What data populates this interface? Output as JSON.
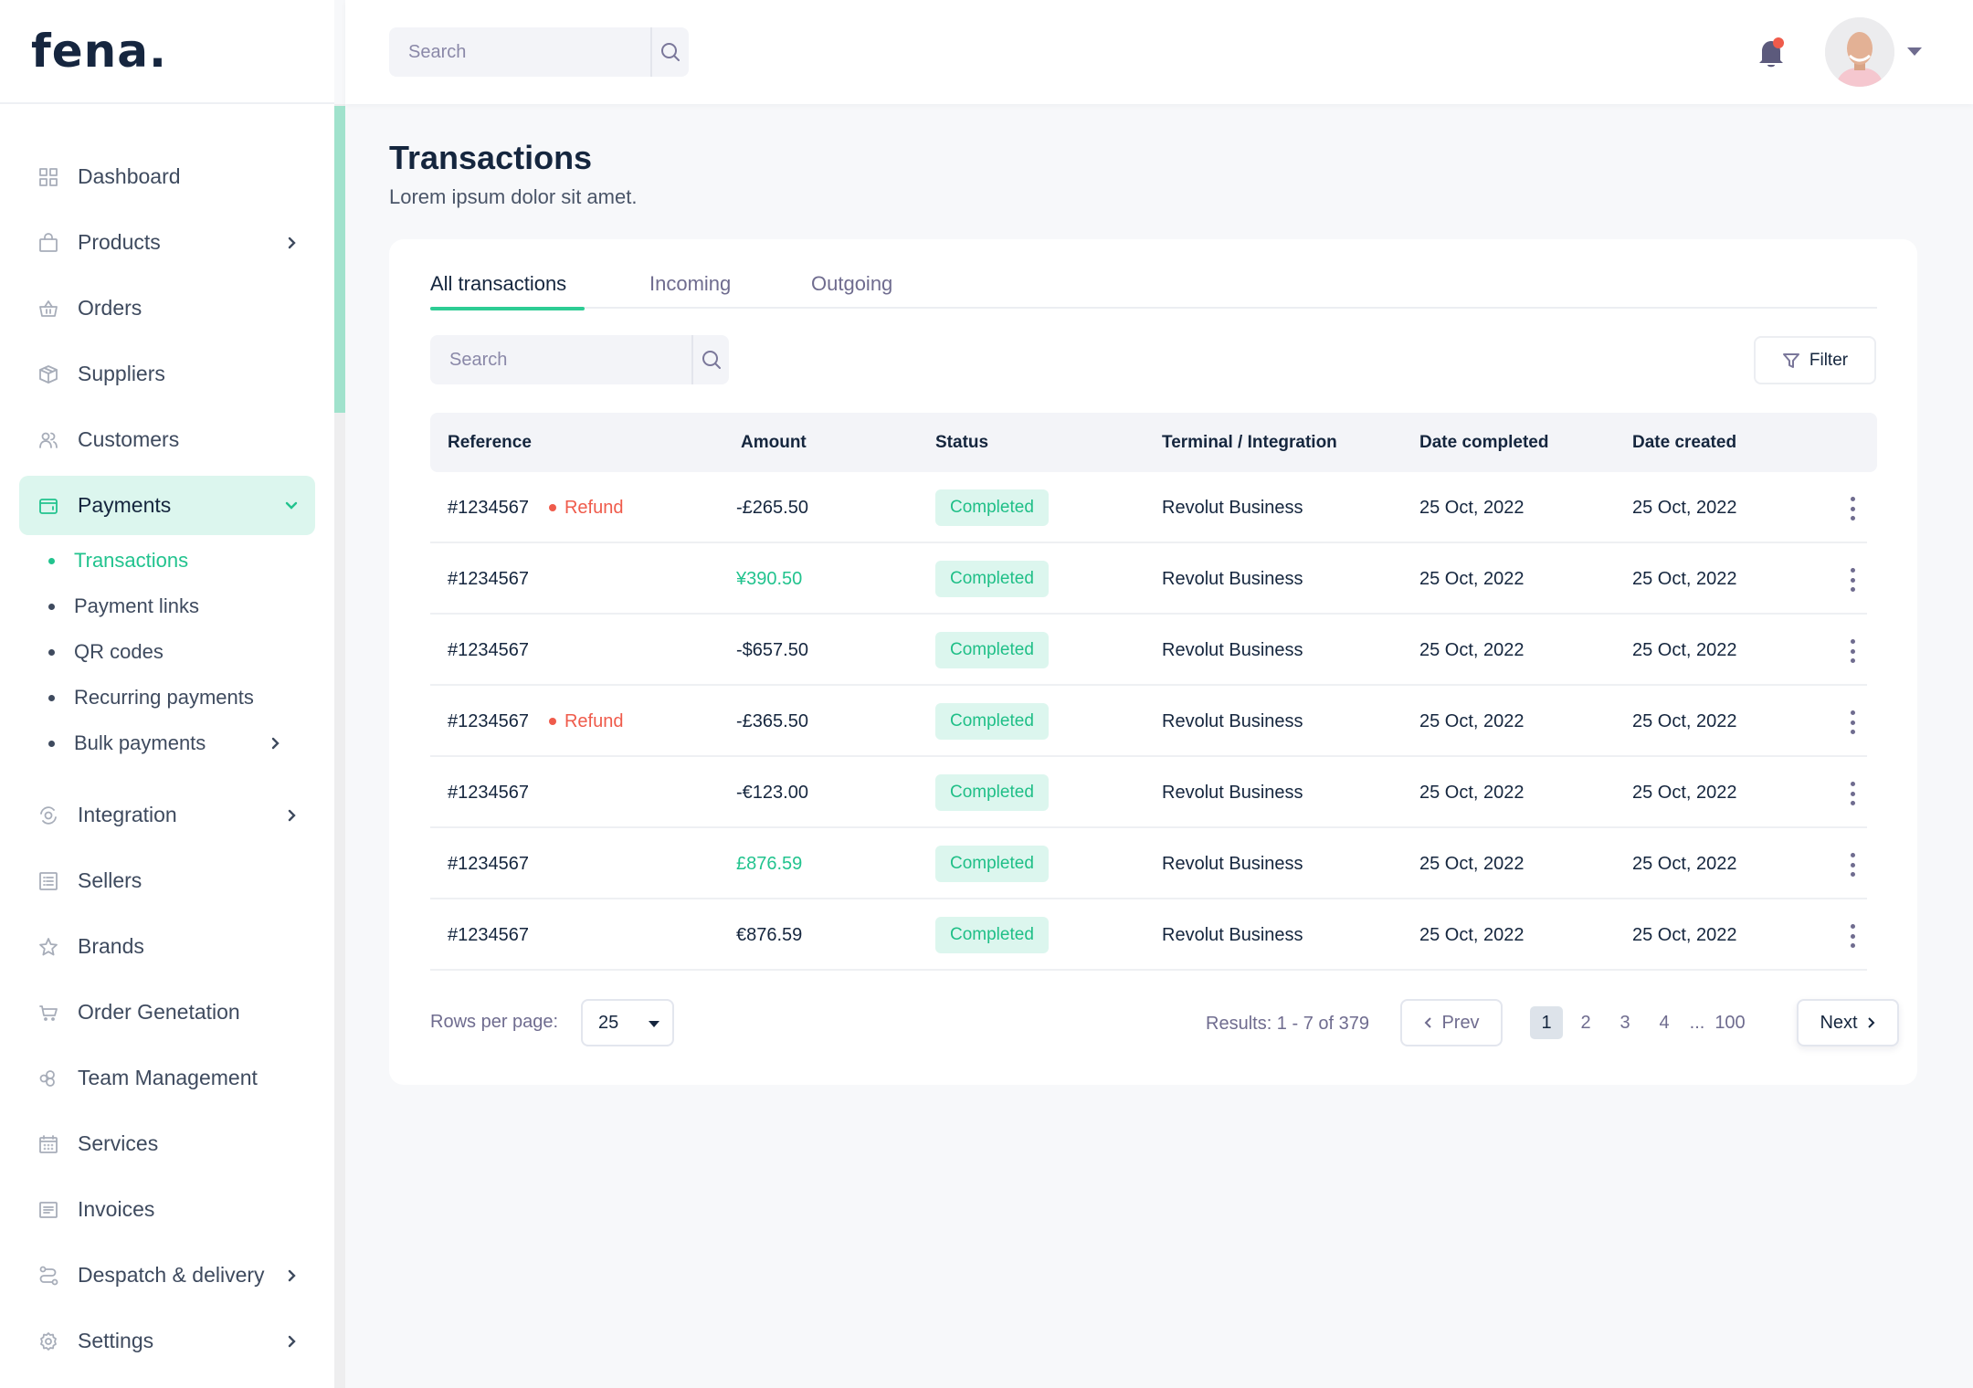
{
  "brand": {
    "logo_text": "fena.",
    "accent": "#2dcc94",
    "text_dark": "#15263e"
  },
  "topbar": {
    "search_placeholder": "Search",
    "notifications_icon": "bell-icon",
    "has_unread_notification": true,
    "avatar_icon": "user-avatar",
    "avatar_menu_icon": "caret-down-icon"
  },
  "sidebar": {
    "items": [
      {
        "label": "Dashboard",
        "icon": "grid-icon",
        "has_chevron": false
      },
      {
        "label": "Products",
        "icon": "shopping-bag-icon",
        "has_chevron": true
      },
      {
        "label": "Orders",
        "icon": "basket-icon",
        "has_chevron": false
      },
      {
        "label": "Suppliers",
        "icon": "package-icon",
        "has_chevron": false
      },
      {
        "label": "Customers",
        "icon": "users-icon",
        "has_chevron": false
      },
      {
        "label": "Payments",
        "icon": "wallet-icon",
        "has_chevron": true,
        "active": true,
        "expanded": true
      },
      {
        "label": "Integration",
        "icon": "sync-icon",
        "has_chevron": true
      },
      {
        "label": "Sellers",
        "icon": "list-icon",
        "has_chevron": false
      },
      {
        "label": "Brands",
        "icon": "star-icon",
        "has_chevron": false
      },
      {
        "label": "Order Genetation",
        "icon": "cart-icon",
        "has_chevron": false
      },
      {
        "label": "Team Management",
        "icon": "team-icon",
        "has_chevron": false
      },
      {
        "label": "Services",
        "icon": "calendar-icon",
        "has_chevron": false
      },
      {
        "label": "Invoices",
        "icon": "invoice-icon",
        "has_chevron": false
      },
      {
        "label": "Despatch & delivery",
        "icon": "route-icon",
        "has_chevron": true
      },
      {
        "label": "Settings",
        "icon": "gear-icon",
        "has_chevron": true
      }
    ],
    "payments_subitems": [
      {
        "label": "Transactions",
        "active": true
      },
      {
        "label": "Payment links"
      },
      {
        "label": "QR codes"
      },
      {
        "label": "Recurring payments"
      },
      {
        "label": "Bulk payments",
        "has_chevron": true
      }
    ]
  },
  "page": {
    "title": "Transactions",
    "subtitle": "Lorem ipsum dolor sit amet."
  },
  "tabs": [
    {
      "label": "All transactions",
      "active": true
    },
    {
      "label": "Incoming"
    },
    {
      "label": "Outgoing"
    }
  ],
  "table_controls": {
    "search_placeholder": "Search",
    "filter_label": "Filter"
  },
  "table": {
    "columns": [
      "Reference",
      "Amount",
      "Status",
      "Terminal / Integration",
      "Date completed",
      "Date created"
    ],
    "rows": [
      {
        "reference": "#1234567",
        "tag": "Refund",
        "amount": "-£265.50",
        "amount_positive": false,
        "status": "Completed",
        "terminal": "Revolut Business",
        "date_completed": "25 Oct, 2022",
        "date_created": "25 Oct, 2022"
      },
      {
        "reference": "#1234567",
        "tag": "",
        "amount": "¥390.50",
        "amount_positive": true,
        "status": "Completed",
        "terminal": "Revolut Business",
        "date_completed": "25 Oct, 2022",
        "date_created": "25 Oct, 2022"
      },
      {
        "reference": "#1234567",
        "tag": "",
        "amount": "-$657.50",
        "amount_positive": false,
        "status": "Completed",
        "terminal": "Revolut Business",
        "date_completed": "25 Oct, 2022",
        "date_created": "25 Oct, 2022"
      },
      {
        "reference": "#1234567",
        "tag": "Refund",
        "amount": "-£365.50",
        "amount_positive": false,
        "status": "Completed",
        "terminal": "Revolut Business",
        "date_completed": "25 Oct, 2022",
        "date_created": "25 Oct, 2022"
      },
      {
        "reference": "#1234567",
        "tag": "",
        "amount": "-€123.00",
        "amount_positive": false,
        "status": "Completed",
        "terminal": "Revolut Business",
        "date_completed": "25 Oct, 2022",
        "date_created": "25 Oct, 2022"
      },
      {
        "reference": "#1234567",
        "tag": "",
        "amount": "£876.59",
        "amount_positive": true,
        "status": "Completed",
        "terminal": "Revolut Business",
        "date_completed": "25 Oct, 2022",
        "date_created": "25 Oct, 2022"
      },
      {
        "reference": "#1234567",
        "tag": "",
        "amount": "€876.59",
        "amount_positive": false,
        "status": "Completed",
        "terminal": "Revolut Business",
        "date_completed": "25 Oct, 2022",
        "date_created": "25 Oct, 2022"
      }
    ]
  },
  "pagination": {
    "rows_per_page_label": "Rows per page:",
    "rows_per_page_value": "25",
    "results_text": "Results: 1 - 7 of 379",
    "prev_label": "Prev",
    "next_label": "Next",
    "pages": [
      "1",
      "2",
      "3",
      "4",
      "...",
      "100"
    ],
    "current_page": "1"
  },
  "colors": {
    "positive_amount": "#22c38e",
    "refund": "#ef5b4b",
    "badge_bg": "#dcf6ee",
    "badge_text": "#1fbf87",
    "scroll_thumb": "#a0e2cc"
  }
}
